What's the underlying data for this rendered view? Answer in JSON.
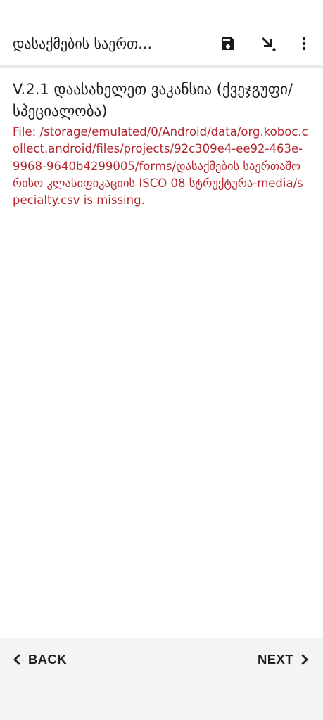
{
  "toolbar": {
    "title": "დასაქმების საერთ…",
    "save_icon": "save-icon",
    "jump_icon": "jump-to-icon",
    "more_icon": "more-vert-icon"
  },
  "question": {
    "label": "V.2.1 დაასახელეთ ვაკანსია (ქვეჯგუფი/სპეციალობა)",
    "error": "File: /storage/emulated/0/Android/data/org.koboc.collect.android/files/projects/92c309e4-ee92-463e-9968-9640b4299005/forms/დასაქმების საერთაშორისო კლასიფიკაციის ISCO 08 სტრუქტურა-media/specialty.csv is missing."
  },
  "navigation": {
    "back_label": "BACK",
    "next_label": "NEXT"
  },
  "colors": {
    "error": "#b3262d",
    "text": "#1f1f1f",
    "nav_background": "#f4f4f4"
  }
}
